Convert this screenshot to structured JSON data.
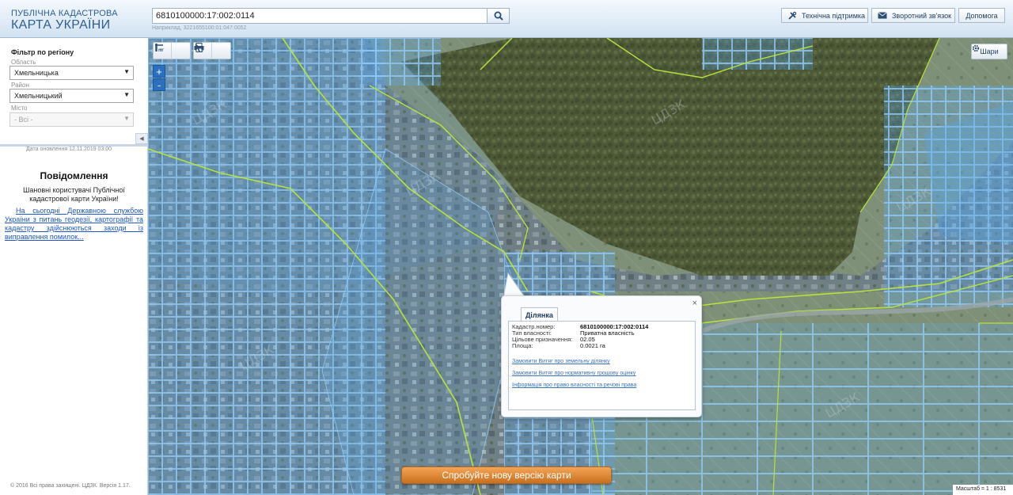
{
  "header": {
    "logo_line1": "ПУБЛІЧНА КАДАСТРОВА",
    "logo_line2": "КАРТА УКРАЇНИ",
    "search_value": "6810100000:17:002:0114",
    "search_hint": "Наприклад, 3221655100:01:047:0052",
    "support_label": "Технічна підтримка",
    "feedback_label": "Зворотний зв'язок",
    "help_label": "Допомога"
  },
  "filter": {
    "title": "Фільтр по регіону",
    "region_label": "Область",
    "region_value": "Хмельницька",
    "district_label": "Район",
    "district_value": "Хмельницький",
    "city_label": "Місто",
    "city_value": "- Всі -"
  },
  "sidebar": {
    "update_date": "Дата оновлення  12.11.2019 03:00",
    "notice_title": "Повідомлення",
    "notice_text": "Шановні користувачі Публічної кадастрової карти України!",
    "notice_link": "На сьогодні Державною службою України з питань геодезії, картографії та кадастру здійснюються заходи із виправлення помилок...",
    "copyright": "© 2016 Всі права захищені. ЦДЗК. Версія 1.17."
  },
  "map": {
    "layers_label": "Шари",
    "new_version_label": "Спробуйте нову версію карти",
    "scale_label": "Масштаб = 1 : 8531",
    "zoom_in": "+",
    "zoom_out": "-",
    "watermark": "ЦДЗК",
    "colors": {
      "parcel_fill": "#5aa6e6",
      "parcel_stroke": "#7ec0f5",
      "boundary": "#b8e33a",
      "forest": "#4f5a38"
    }
  },
  "popup": {
    "tab_label": "Ділянка",
    "rows": [
      {
        "key": "Кадастр.номер:",
        "value": "6810100000:17:002:0114"
      },
      {
        "key": "Тип власності:",
        "value": "Приватна власність"
      },
      {
        "key": "Цільове призначення:",
        "value": "02.05"
      },
      {
        "key": "Площа:",
        "value": "0.0021 га"
      }
    ],
    "links": [
      "Замовити Витяг про земельну ділянку",
      "Замовити Витяг про нормативну грошову оцінку",
      "Інформація про право власності та речові права"
    ],
    "close": "×"
  }
}
